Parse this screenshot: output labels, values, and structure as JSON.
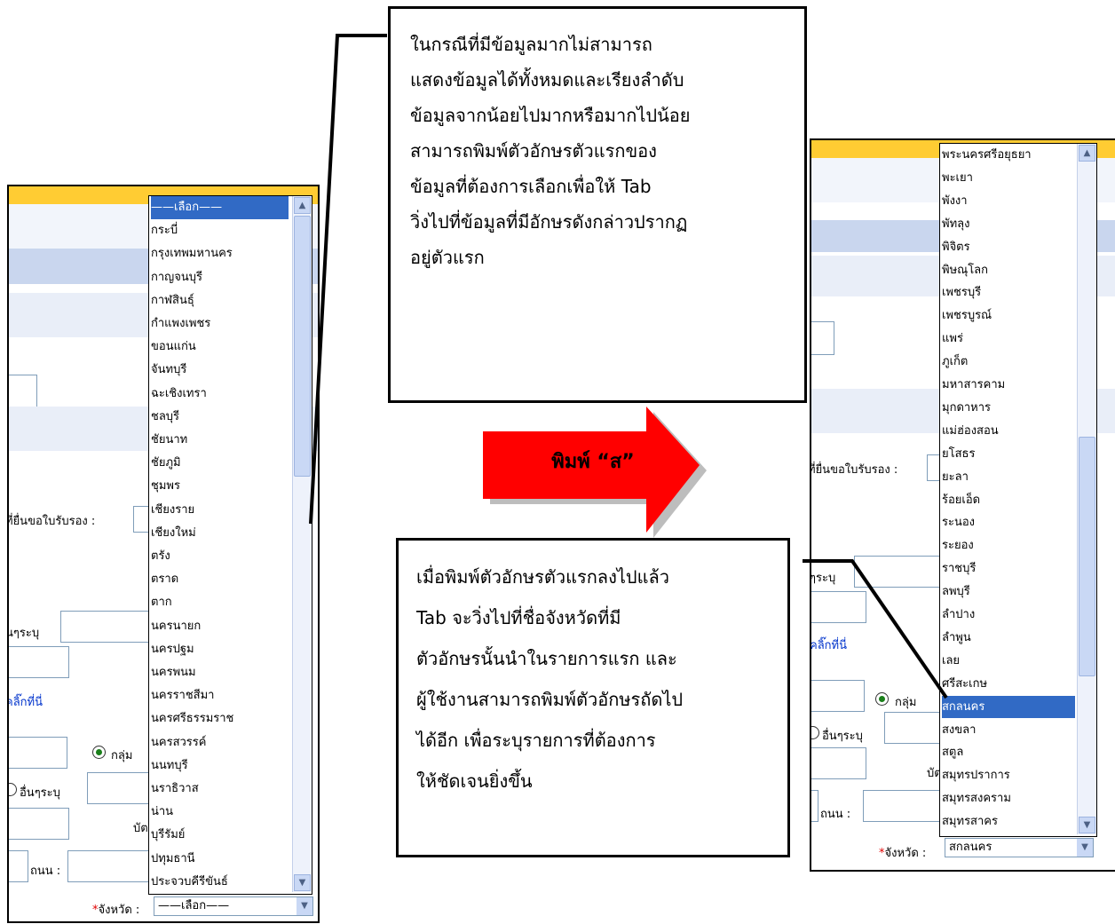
{
  "left_screen": {
    "dropdown_items": [
      "——เลือก——",
      "กระบี่",
      "กรุงเทพมหานคร",
      "กาญจนบุรี",
      "กาฬสินธุ์",
      "กำแพงเพชร",
      "ขอนแก่น",
      "จันทบุรี",
      "ฉะเชิงเทรา",
      "ชลบุรี",
      "ชัยนาท",
      "ชัยภูมิ",
      "ชุมพร",
      "เชียงราย",
      "เชียงใหม่",
      "ตรัง",
      "ตราด",
      "ตาก",
      "นครนายก",
      "นครปฐม",
      "นครพนม",
      "นครราชสีมา",
      "นครศรีธรรมราช",
      "นครสวรรค์",
      "นนทบุรี",
      "นราธิวาส",
      "น่าน",
      "บุรีรัมย์",
      "ปทุมธานี",
      "ประจวบคีรีขันธ์"
    ],
    "selected_item": "——เลือก——",
    "form": {
      "cert_label": "ที่ยื่นขอใบรับรอง :",
      "other_label_1": "นๆระบุ",
      "click_here": "คลิ๊กที่นี่",
      "group_label": "กลุ่ม",
      "other_label_2": "อื่นๆระบุ",
      "card_label": "บัต",
      "road_label": "ถนน :",
      "province_required": "*",
      "province_label": "จังหวัด :",
      "province_value": "——เลือก——"
    }
  },
  "right_screen": {
    "dropdown_items": [
      "พระนครศรีอยุธยา",
      "พะเยา",
      "พังงา",
      "พัทลุง",
      "พิจิตร",
      "พิษณุโลก",
      "เพชรบุรี",
      "เพชรบูรณ์",
      "แพร่",
      "ภูเก็ต",
      "มหาสารคาม",
      "มุกดาหาร",
      "แม่ฮ่องสอน",
      "ยโสธร",
      "ยะลา",
      "ร้อยเอ็ด",
      "ระนอง",
      "ระยอง",
      "ราชบุรี",
      "ลพบุรี",
      "ลำปาง",
      "ลำพูน",
      "เลย",
      "ศรีสะเกษ",
      "สกลนคร",
      "สงขลา",
      "สตูล",
      "สมุทรปราการ",
      "สมุทรสงคราม",
      "สมุทรสาคร"
    ],
    "selected_item": "สกลนคร",
    "form": {
      "cert_label": "ที่ยื่นขอใบรับรอง :",
      "other_label_1": "ๆระบุ",
      "click_here": "คลิ๊กที่นี่",
      "group_label": "กลุ่ม",
      "other_label_2": "อื่นๆระบุ",
      "card_label": "บัต",
      "road_label": "ถนน :",
      "province_required": "*",
      "province_label": "จังหวัด :",
      "province_value": "สกลนคร"
    }
  },
  "callout_top": "ในกรณีที่มีข้อมูลมากไม่สามารถ\nแสดงข้อมูลได้ทั้งหมดและเรียงลำดับ\nข้อมูลจากน้อยไปมากหรือมากไปน้อย\nสามารถพิมพ์ตัวอักษรตัวแรกของ\nข้อมูลที่ต้องการเลือกเพื่อให้ Tab\nวิ่งไปที่ข้อมูลที่มีอักษรดังกล่าวปรากฏ\nอยู่ตัวแรก",
  "arrow_label": "พิมพ์ “ส”",
  "callout_bottom": "เมื่อพิมพ์ตัวอักษรตัวแรกลงไปแล้ว\nTab จะวิ่งไปที่ชื่อจังหวัดที่มี\nตัวอักษรนั้นนำในรายการแรก และ\nผู้ใช้งานสามารถพิมพ์ตัวอักษรถัดไป\nได้อีก เพื่อระบุรายการที่ต้องการ\nให้ชัดเจนยิ่งขึ้น",
  "colors": {
    "arrow_fill": "#ff0000",
    "highlight": "#316ac5",
    "header_bar": "#ffcc33"
  }
}
